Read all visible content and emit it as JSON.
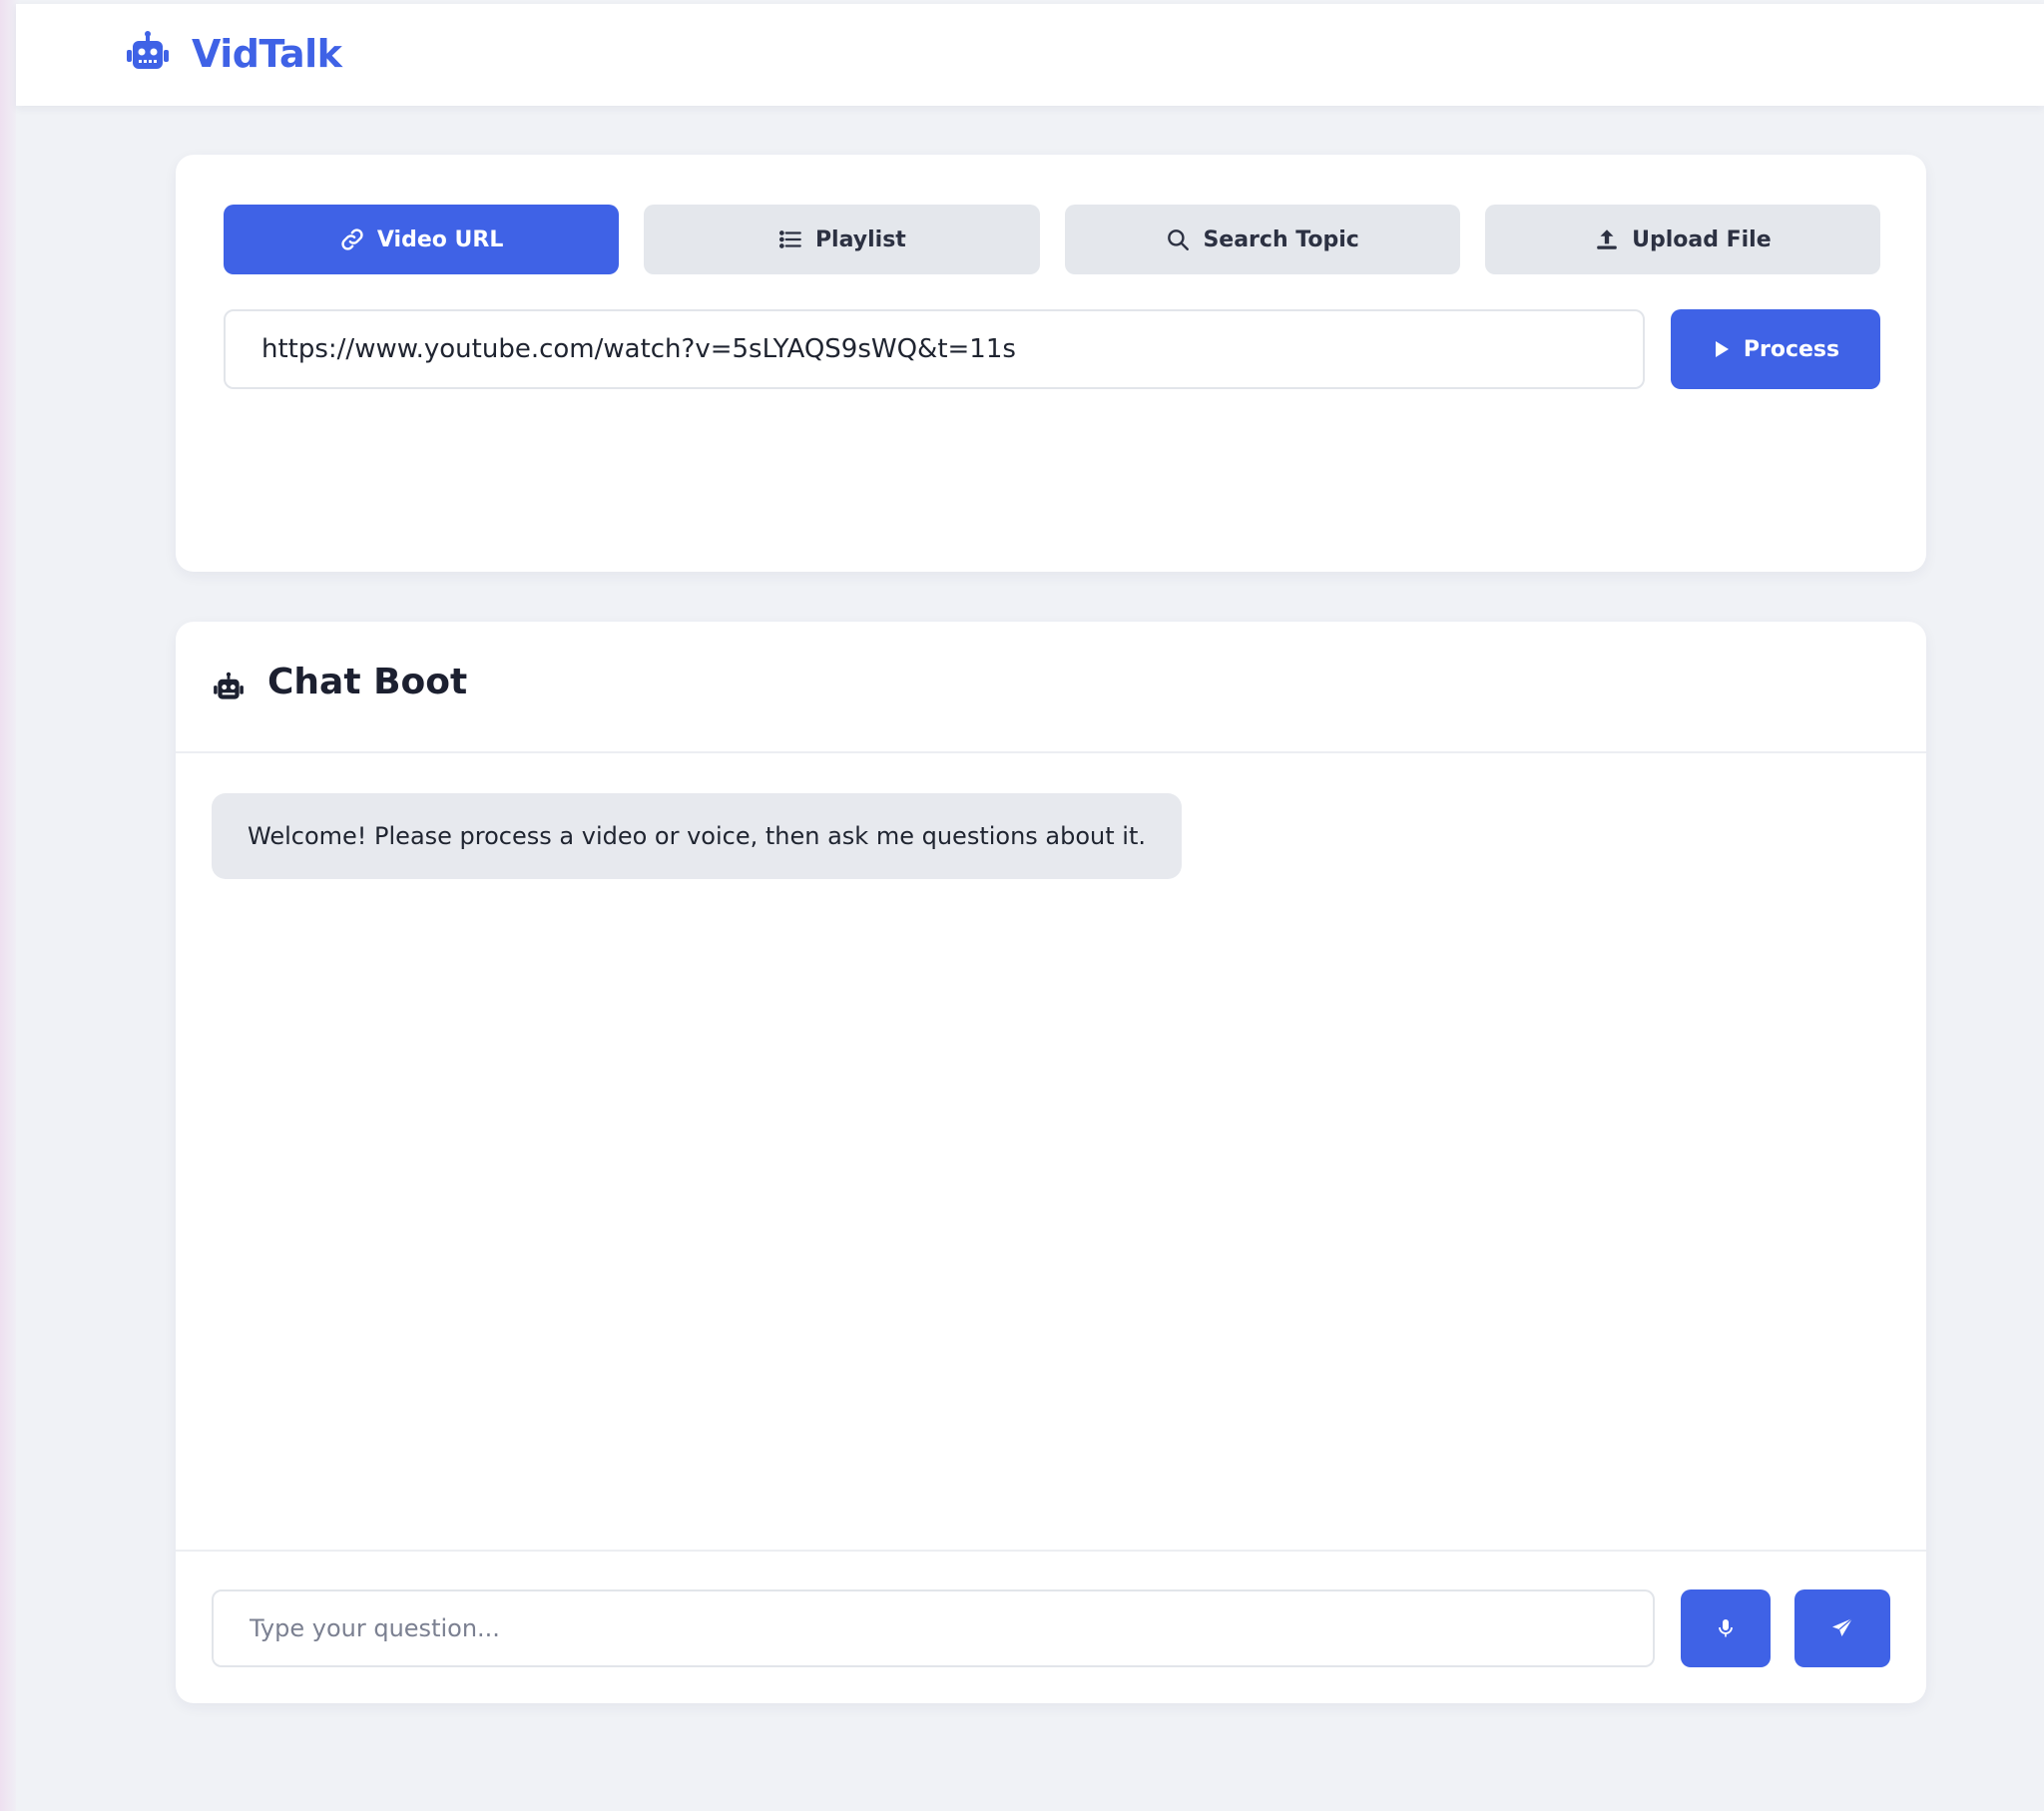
{
  "app": {
    "brand_name": "VidTalk"
  },
  "source_tabs": [
    {
      "label": "Video URL",
      "icon": "link-icon",
      "active": true
    },
    {
      "label": "Playlist",
      "icon": "list-icon",
      "active": false
    },
    {
      "label": "Search Topic",
      "icon": "search-icon",
      "active": false
    },
    {
      "label": "Upload File",
      "icon": "upload-icon",
      "active": false
    }
  ],
  "url_input": {
    "value": "https://www.youtube.com/watch?v=5sLYAQS9sWQ&t=11s"
  },
  "process_button": {
    "label": "Process",
    "icon": "play-icon"
  },
  "chat": {
    "title": "Chat Boot",
    "icon": "robot-icon",
    "messages": [
      {
        "role": "bot",
        "text": "Welcome! Please process a video or voice, then ask me questions about it."
      }
    ],
    "input_placeholder": "Type your question...",
    "mic_icon": "microphone-icon",
    "send_icon": "send-icon"
  },
  "colors": {
    "accent": "#3f62e6",
    "background": "#f0f2f6",
    "card": "#ffffff",
    "tab_inactive": "#e4e7ec",
    "bubble_bot": "#e7e9ee"
  }
}
